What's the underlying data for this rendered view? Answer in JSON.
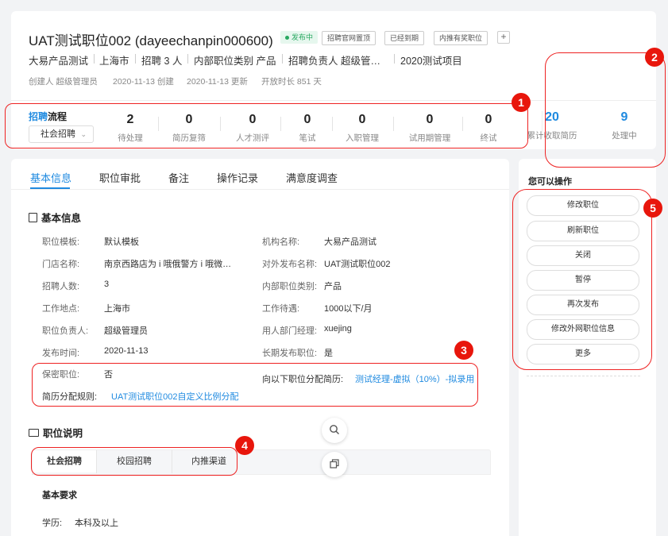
{
  "header": {
    "title": "UAT测试职位002 (dayeechanpin000600)",
    "status": "发布中",
    "tags": [
      "招聘官网置顶",
      "已经到期",
      "内推有奖职位"
    ],
    "add_label": "+",
    "meta": [
      "大易产品测试",
      "上海市",
      "招聘 3 人",
      "内部职位类别 产品",
      "招聘负责人 超级管…",
      "2020测试项目"
    ],
    "sub": {
      "creator": "创建人 超级管理员",
      "created": "2020-11-13 创建",
      "updated": "2020-11-13 更新",
      "duration": "开放时长 851 天"
    }
  },
  "pipeline": {
    "title_prefix": "招聘",
    "title_suffix": "流程",
    "select_value": "社会招聘",
    "stages": [
      {
        "count": "2",
        "label": "待处理"
      },
      {
        "count": "0",
        "label": "简历复筛"
      },
      {
        "count": "0",
        "label": "人才测评"
      },
      {
        "count": "0",
        "label": "笔试"
      },
      {
        "count": "0",
        "label": "入职管理"
      },
      {
        "count": "0",
        "label": "试用期管理"
      },
      {
        "count": "0",
        "label": "终试"
      }
    ]
  },
  "stats": [
    {
      "count": "20",
      "label": "累计收取简历"
    },
    {
      "count": "9",
      "label": "处理中"
    }
  ],
  "tabs": [
    "基本信息",
    "职位审批",
    "备注",
    "操作记录",
    "满意度调查"
  ],
  "basic_info": {
    "heading": "基本信息",
    "left": [
      {
        "label": "职位模板:",
        "value": "默认模板"
      },
      {
        "label": "门店名称:",
        "value": "南京西路店为 i 哦俄警方 i 哦微…"
      },
      {
        "label": "招聘人数:",
        "value": "3"
      },
      {
        "label": "工作地点:",
        "value": "上海市"
      },
      {
        "label": "职位负责人:",
        "value": "超级管理员"
      },
      {
        "label": "发布时间:",
        "value": "2020-11-13"
      }
    ],
    "right": [
      {
        "label": "机构名称:",
        "value": "大易产品测试"
      },
      {
        "label": "对外发布名称:",
        "value": "UAT测试职位002"
      },
      {
        "label": "内部职位类别:",
        "value": "产品"
      },
      {
        "label": "工作待遇:",
        "value": "1000以下/月"
      },
      {
        "label": "用人部门经理:",
        "value": "xuejing"
      },
      {
        "label": "长期发布职位:",
        "value": "是"
      }
    ],
    "secret_label": "保密职位:",
    "secret_value": "否",
    "assign_label": "向以下职位分配简历:",
    "assign_value": "测试经理-虚拟（10%）-拟录用",
    "rule_label": "简历分配规则:",
    "rule_value": "UAT测试职位002自定义比例分配"
  },
  "job_desc": {
    "heading": "职位说明",
    "channels": [
      "社会招聘",
      "校园招聘",
      "内推渠道"
    ],
    "req_heading": "基本要求",
    "edu_label": "学历:",
    "edu_value": "本科及以上"
  },
  "actions": {
    "heading": "您可以操作",
    "buttons": [
      "修改职位",
      "刷新职位",
      "关闭",
      "暂停",
      "再次发布",
      "修改外网职位信息",
      "更多"
    ]
  },
  "annotations": [
    "1",
    "2",
    "3",
    "4",
    "5"
  ],
  "colors": {
    "accent": "#1f8ae0",
    "annotation": "#e8160c",
    "status": "#28a860"
  }
}
